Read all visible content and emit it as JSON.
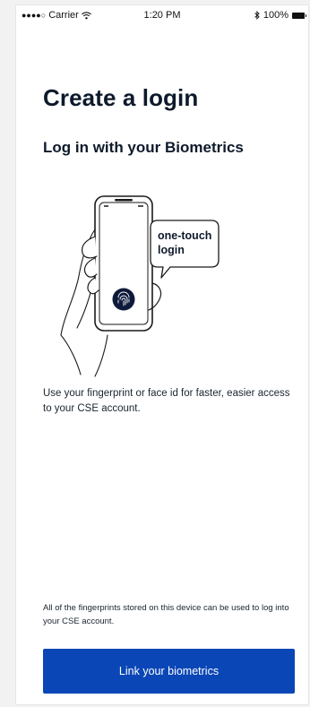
{
  "status_bar": {
    "signal": "●●●●○",
    "carrier": "Carrier",
    "wifi_icon": "wifi-icon",
    "time": "1:20 PM",
    "bluetooth_icon": "bluetooth-icon",
    "battery_percent": "100%",
    "battery_icon": "battery-icon"
  },
  "page": {
    "title": "Create a login",
    "subtitle": "Log in with your Biometrics",
    "description": "Use your fingerprint or face id for faster, easier access to your CSE account.",
    "note": "All of the fingerprints stored on this device can be used to log into your CSE account."
  },
  "illustration": {
    "bubble_line1": "one-touch",
    "bubble_line2": "login",
    "icon": "fingerprint-icon"
  },
  "actions": {
    "primary_label": "Link your biometrics"
  },
  "colors": {
    "primary_button": "#0a46b6",
    "heading": "#0e1a2b",
    "fingerprint_circle": "#0e1a3a"
  }
}
